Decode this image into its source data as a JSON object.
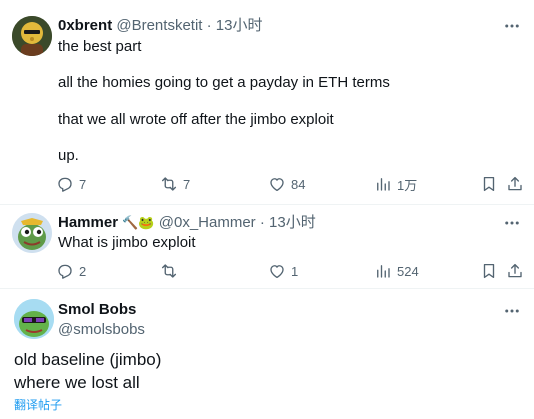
{
  "tweets": [
    {
      "name": "0xbrent",
      "handle": "@Brentsketit",
      "time": "13小时",
      "lines": [
        "the best part",
        "all the homies going to get a payday in ETH terms",
        "that we all wrote off after the jimbo exploit",
        "up."
      ],
      "actions": {
        "replies": "7",
        "retweets": "7",
        "likes": "84",
        "views": "1万"
      }
    },
    {
      "name": "Hammer",
      "name_emoji": "🔨🐸",
      "handle": "@0x_Hammer",
      "time": "13小时",
      "lines": [
        "What is jimbo exploit"
      ],
      "actions": {
        "replies": "2",
        "retweets": "",
        "likes": "1",
        "views": "524"
      }
    },
    {
      "name": "Smol Bobs",
      "handle": "@smolsbobs",
      "lines": [
        "old baseline (jimbo)",
        "where we lost all"
      ],
      "translate_label": "翻译帖子"
    }
  ],
  "separator": "·",
  "icons": {
    "more": "more-icon",
    "reply": "reply-icon",
    "retweet": "retweet-icon",
    "like": "heart-icon",
    "views": "views-icon",
    "bookmark": "bookmark-icon",
    "share": "share-icon"
  },
  "colors": {
    "text": "#0f1419",
    "secondary": "#536471",
    "link": "#1d9bf0",
    "divider": "#eff3f4"
  }
}
